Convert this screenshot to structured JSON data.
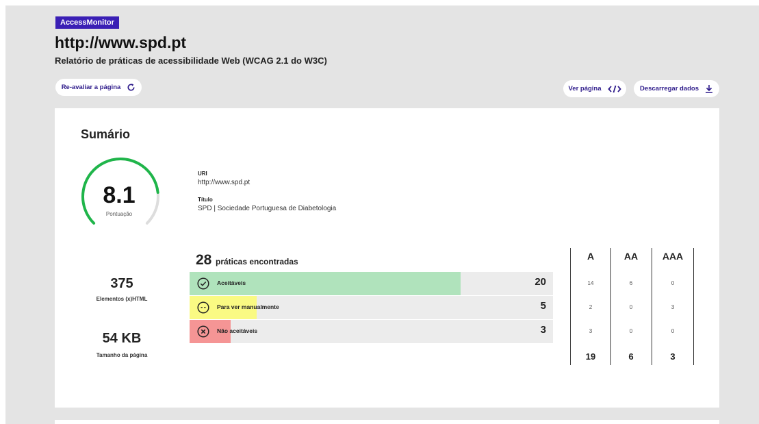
{
  "header": {
    "brand": "AccessMonitor",
    "url": "http://www.spd.pt",
    "subtitle": "Relatório de práticas de acessibilidade Web (WCAG 2.1 do W3C)",
    "reevaluate_label": "Re-avaliar a página",
    "view_page_label": "Ver página",
    "download_label": "Descarregar dados"
  },
  "summary": {
    "title": "Sumário",
    "score": "8.1",
    "score_max": 10,
    "score_label": "Pontuação",
    "uri_label": "URI",
    "uri_value": "http://www.spd.pt",
    "title_label": "Título",
    "title_value": "SPD | Sociedade Portuguesa de Diabetologia",
    "elements_value": "375",
    "elements_label": "Elementos (x)HTML",
    "size_value": "54 KB",
    "size_label": "Tamanho da página"
  },
  "practices": {
    "count": "28",
    "count_label": "práticas encontradas",
    "columns": [
      "A",
      "AA",
      "AAA"
    ],
    "rows": [
      {
        "label": "Aceitáveis",
        "count": "20",
        "icon": "check-circle-icon",
        "color": "#b0e3bc",
        "fill_fraction": 0.745,
        "levels": [
          "14",
          "6",
          "0"
        ]
      },
      {
        "label": "Para ver manualmente",
        "count": "5",
        "icon": "dash-circle-icon",
        "color": "#fafa83",
        "fill_fraction": 0.185,
        "levels": [
          "2",
          "0",
          "3"
        ]
      },
      {
        "label": "Não aceitáveis",
        "count": "3",
        "icon": "x-circle-icon",
        "color": "#f59595",
        "fill_fraction": 0.113,
        "levels": [
          "3",
          "0",
          "0"
        ]
      }
    ],
    "totals": [
      "19",
      "6",
      "3"
    ]
  },
  "colors": {
    "brand": "#3a1fb5",
    "gauge": "#1fb54a",
    "gauge_track": "#dddddd"
  }
}
